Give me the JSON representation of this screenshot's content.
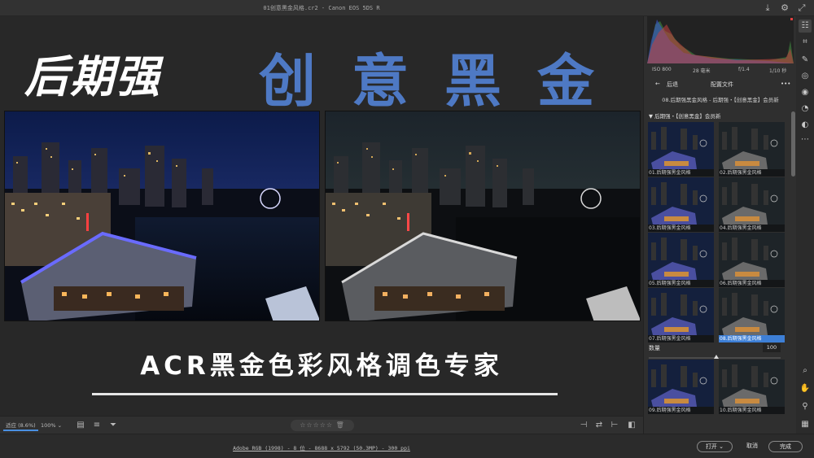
{
  "window": {
    "title": "01创意黑金风格.cr2 - Canon EOS 5DS R"
  },
  "canvas": {
    "brand": "后期强",
    "headline": "创意黑金",
    "subtitle": "ACR黑金色彩风格调色专家"
  },
  "bottombar": {
    "fit_label": "适应 (8.6%)",
    "zoom_value": "100%",
    "rating_stars": "☆☆☆☆☆",
    "rating_trash": "🗑"
  },
  "statusbar": {
    "metadata": "Adobe RGB (1998) - 8 位 - 8688 x 5792 (50.3MP) - 300 ppi",
    "open_label": "打开",
    "cancel_label": "取消",
    "done_label": "完成"
  },
  "histogram": {
    "iso": "ISO 800",
    "focal": "28 毫米",
    "aperture": "f/1.4",
    "shutter": "1/10 秒"
  },
  "presets": {
    "back_label": "后退",
    "panel_title": "配置文件",
    "more_label": "•••",
    "breadcrumb": "08.后期强黑金风格 - 后期强・【创意黑金】会员新",
    "group_label": "▼ 后期强・【创意黑金】会员新",
    "items": [
      {
        "label": "01.后期强黑金风格"
      },
      {
        "label": "02.后期强黑金风格"
      },
      {
        "label": "03.后期强黑金风格"
      },
      {
        "label": "04.后期强黑金风格"
      },
      {
        "label": "05.后期强黑金风格"
      },
      {
        "label": "06.后期强黑金风格"
      },
      {
        "label": "07.后期强黑金风格"
      },
      {
        "label": "08.后期强黑金风格"
      },
      {
        "label": "09.后期强黑金风格"
      },
      {
        "label": "10.后期强黑金风格"
      }
    ],
    "amount_label": "数量",
    "amount_value": "100"
  },
  "colors": {
    "accent": "#4a90e2",
    "headline": "#4e79c4",
    "selection": "#3d7fd6"
  }
}
